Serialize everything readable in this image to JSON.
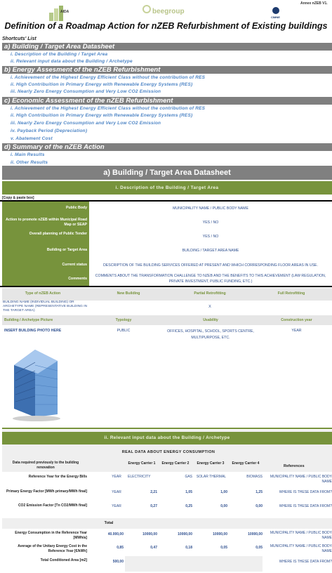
{
  "header": {
    "annex": "Annex nZEB V1.",
    "aida_logo": "AIDA",
    "bee_logo": "beegroup",
    "cimne_logo": "CIMNE"
  },
  "title": "Definition of a Roadmap Action for nZEB Refurbishment of Existing buildings",
  "shortcuts_label": "Shortcuts' List",
  "sections": [
    {
      "title": "a) Building / Target Area Datasheet",
      "items": [
        "i. Description of the Building / Target Area",
        "ii. Relevant input data about the Building / Archetype"
      ]
    },
    {
      "title": "b) Energy Assesment of the nZEB Refurbishment",
      "items": [
        "i. Achievement of the Highest Energy Efficient Class without the contribution of RES",
        "ii. High Contribuition in Primary Energy with Renewable Energy Systems (RES)",
        "iii. Nearly Zero Energy Consumption and Very Low CO2 Emission"
      ]
    },
    {
      "title": "c) Economic Assessment of the nZEB Refurbishment",
      "items": [
        "i. Achievement of the Highest Energy Efficient Class without the contribution of RES",
        "ii. High Contribuition in Primary Energy with Renewable Energy Systems (RES)",
        "iii. Nearly Zero Energy Consumption and Very Low CO2 Emission",
        "iv. Payback Period (Depreciation)",
        "v. Abatement Cost"
      ]
    },
    {
      "title": "d) Summary of the nZEB Action",
      "items": [
        "i. Main Results",
        "ii. Other Results"
      ]
    }
  ],
  "datasheet": {
    "heading": "a) Building / Target Area Datasheet",
    "subheading": "i. Description of the Building / Target Area",
    "copy_note": "[Copy & paste box]",
    "rows": [
      {
        "label": "Public Body",
        "value": "MUNICIPALITY NAME / PUBLIC BODY NAME"
      },
      {
        "label": "Action to promote nZEB within Municipal Road Map or SEAP",
        "value": "YES / NO"
      },
      {
        "label": "Overall planning of Public Tender",
        "value": "YES / NO"
      },
      {
        "label": "Building or Target Area",
        "value": "BUILDING / TARGET AREA NAME"
      },
      {
        "label": "Current status",
        "value": "DESCRIPTION OF THE BUILDING SERVICES OFFERED AT PRESENT AND WHICH CORRESPONDING FLOOR AREAS IN USE."
      },
      {
        "label": "Comments",
        "value": "COMMENTS ABOUT THE TRANSFORMATION CHALLENGE TO NZEB AND THE BENEFITS TO THIS ACHIEVEMENT (LAW REGULATION, PRIVATE INVESTMENT, PUBLIC FUNDING, ETC.)"
      }
    ],
    "action_headers": [
      "Type of nZEB Action",
      "New Building",
      "Partial Retrofitting",
      "Full Retrofitting"
    ],
    "action_row": {
      "name": "BUILDING NAME (INDIVIDUAL BUILDING) OR ARCHETYPE NAME (REPRESENTATIVE BUILDING IN THE TARGET AREA)",
      "mark": "X"
    },
    "picture_headers": [
      "Building / Archetype Picture",
      "Typology",
      "Usability",
      "Construction year"
    ],
    "picture_row": {
      "photo": "INSERT BUILDING PHOTO HERE",
      "typology": "PUBLIC",
      "usability": "OFFICES, HOSPITAL, SCHOOL, SPORTS CENTRE, MULTIPURPOSE, ETC.",
      "year": "YEAR"
    }
  },
  "energy": {
    "subheading": "ii. Relevant input data about the Building / Archetype",
    "real_data_title": "REAL DATA ABOUT ENERGY CONSUMPTION",
    "col_label": "Data required previously to the building renovation",
    "carriers": [
      "Energy Carrier 1",
      "Energy Carrier 2",
      "Energy Carrier 3",
      "Energy Carrier 4"
    ],
    "references_label": "References",
    "total_label": "Total",
    "ref_year": {
      "label": "Reference Year for the Energy Bills",
      "year": "YEAR",
      "carriers": [
        "ELECTRICITY",
        "GAS",
        "SOLAR THERMAL",
        "BIOMASS"
      ],
      "ref": "MUNICIPALITY NAME / PUBLIC BODY NAME"
    },
    "pef": {
      "label": "Primary Energy Factor [MWh primary/MWh final]",
      "year": "YEAR",
      "values": [
        "2,21",
        "1,05",
        "1,00",
        "1,25"
      ],
      "ref": "WHERE IS THESE DATA FROM?"
    },
    "co2": {
      "label": "CO2 Emission Factor [Tn CO2/MWh final]",
      "year": "YEAR",
      "values": [
        "0,27",
        "0,25",
        "0,00",
        "0,00"
      ],
      "ref": "WHERE IS THESE DATA FROM?"
    },
    "consumption": {
      "label": "Energy Consumption in the Reference Year [MWh/a]",
      "total": "40.000,00",
      "values": [
        "10000,00",
        "10000,00",
        "10000,00",
        "10000,00"
      ],
      "ref": "MUNICIPALITY NAME / PUBLIC BODY NAME"
    },
    "cost": {
      "label": "Average of the Unitary Energy Cost in the Reference Year [€/kWh]",
      "total": "0,85",
      "values": [
        "0,47",
        "0,18",
        "0,05",
        "0,05"
      ],
      "ref": "MUNICIPALITY NAME / PUBLIC BODY NAME"
    },
    "area": {
      "label": "Total Conditioned Area [m2]",
      "total": "500,00",
      "ref": "WHERE IS THESE DATA FROM?"
    }
  }
}
